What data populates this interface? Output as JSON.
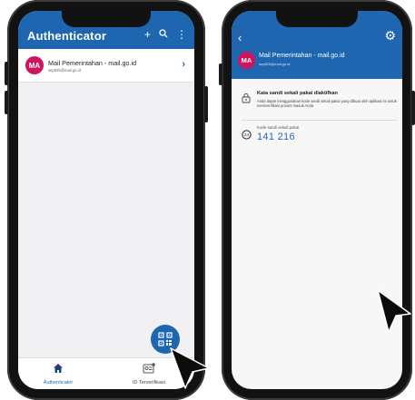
{
  "left_phone": {
    "appbar": {
      "title": "Authenticator",
      "icons": [
        "add-icon",
        "search-icon",
        "more-vert-icon"
      ],
      "add_glyph": "+",
      "more_glyph": "⋮"
    },
    "account": {
      "initials": "MA",
      "name": "Mail Pemerintahan - mail.go.id",
      "email": "sep825@mail.go.id",
      "chevron": "›"
    },
    "fab_icon": "qr-code-scan-icon",
    "bottom_nav": [
      {
        "label": "Authenticator",
        "icon": "home-icon",
        "active": true
      },
      {
        "label": "ID Terverifikasi",
        "icon": "id-card-icon",
        "active": false
      }
    ]
  },
  "right_phone": {
    "header": {
      "back_glyph": "‹",
      "gear_glyph": "⚙",
      "initials": "MA",
      "name": "Mail Pemerintahan - mail.go.id",
      "email": "sep825@mail.go.id"
    },
    "info": {
      "title": "Kata sandi sekali pakai diaktifkan",
      "body": "Anda dapat menggunakan kode sandi sekali pakai yang dibuat oleh aplikasi ini untuk memverifikasi proses masuk Anda"
    },
    "otp": {
      "label": "Kode sandi sekali pakai",
      "code": "141 216",
      "timer": "24"
    }
  },
  "colors": {
    "primary": "#1f66b1",
    "avatar": "#d0135d",
    "frame": "#121212"
  }
}
